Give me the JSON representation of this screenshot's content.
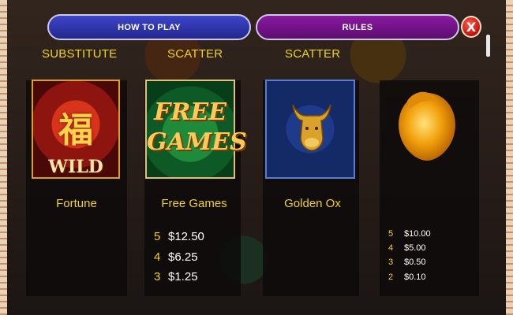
{
  "tabs": {
    "how_to_play": "HOW TO PLAY",
    "rules": "RULES",
    "close": "X"
  },
  "headings": {
    "substitute": "SUBSTITUTE",
    "scatter_1": "SCATTER",
    "scatter_2": "SCATTER"
  },
  "symbols": [
    {
      "name": "Fortune",
      "icon": "wild-fortune-icon",
      "art_text": "WILD",
      "glyph": "福"
    },
    {
      "name": "Free Games",
      "icon": "free-games-icon",
      "art_lines": [
        "FREE",
        "GAMES"
      ],
      "pays": [
        {
          "count": "5",
          "amount": "$12.50"
        },
        {
          "count": "4",
          "amount": "$6.25"
        },
        {
          "count": "3",
          "amount": "$1.25"
        }
      ]
    },
    {
      "name": "Golden Ox",
      "icon": "golden-ox-icon"
    },
    {
      "name": "",
      "icon": "golden-peach-icon",
      "pays": [
        {
          "count": "5",
          "amount": "$10.00"
        },
        {
          "count": "4",
          "amount": "$5.00"
        },
        {
          "count": "3",
          "amount": "$0.50"
        },
        {
          "count": "2",
          "amount": "$0.10"
        }
      ]
    }
  ],
  "colors": {
    "heading_yellow": "#f2d21a",
    "how_to_play_tab": "#2f36b0",
    "rules_tab": "#75158a",
    "close_red": "#d4160d"
  }
}
